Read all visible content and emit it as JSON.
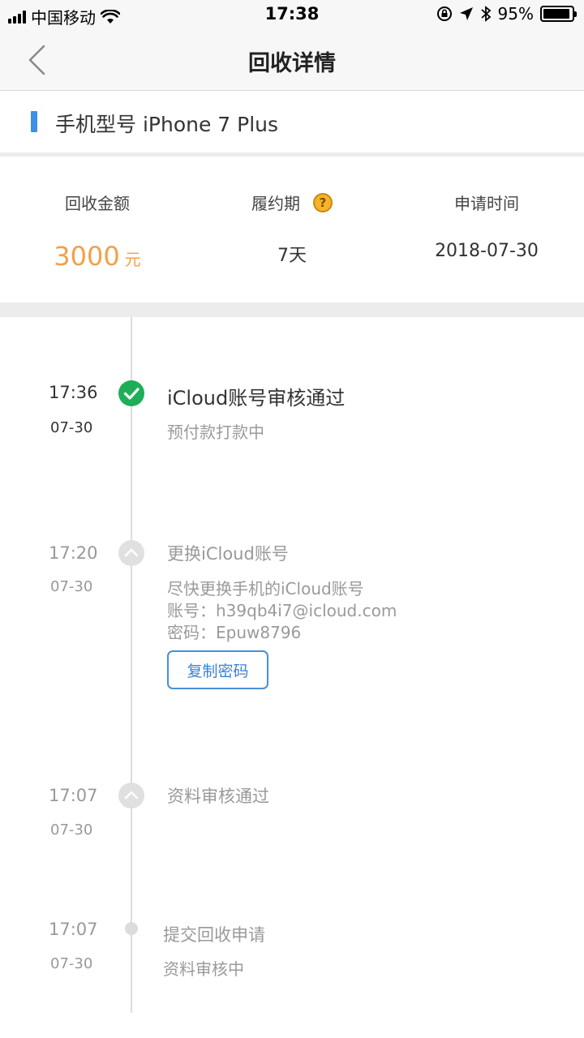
{
  "status_bar": {
    "carrier": "中国移动",
    "time": "17:38",
    "battery_percent": "95%",
    "battery_level": 0.95,
    "icons": [
      "signal-icon",
      "wifi-icon",
      "orientation-lock-icon",
      "location-icon",
      "bluetooth-icon",
      "battery-icon"
    ]
  },
  "nav": {
    "title": "回收详情",
    "back_icon": "chevron-left-icon"
  },
  "model": {
    "text": "手机型号 iPhone 7 Plus",
    "accent_color": "#3d8fe8"
  },
  "summary": {
    "amount_label": "回收金额",
    "amount_value": "3000",
    "amount_unit": "元",
    "period_label": "履约期",
    "period_value": "7天",
    "help_icon": "question-circle-icon",
    "apply_label": "申请时间",
    "apply_value": "2018-07-30",
    "accent_color": "#f2a04a"
  },
  "timeline": {
    "items": [
      {
        "time": "17:36",
        "date": "07-30",
        "title": "iCloud账号审核通过",
        "lines": [
          "预付款打款中"
        ],
        "icon": "check-circle-icon"
      },
      {
        "time": "17:20",
        "date": "07-30",
        "title": "更换iCloud账号",
        "lines": [
          "尽快更换手机的iCloud账号",
          "账号：h39qb4i7@icloud.com",
          "密码：Epuw8796"
        ],
        "button": "复制密码",
        "icon": "chevron-up-circle-icon"
      },
      {
        "time": "17:07",
        "date": "07-30",
        "title": "资料审核通过",
        "lines": [],
        "icon": "chevron-up-circle-icon"
      },
      {
        "time": "17:07",
        "date": "07-30",
        "title": "提交回收申请",
        "lines": [
          "资料审核中"
        ],
        "icon": "dot-icon"
      }
    ],
    "success_color": "#1fae58"
  }
}
